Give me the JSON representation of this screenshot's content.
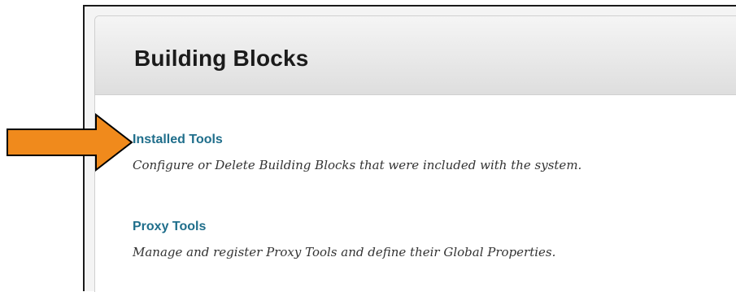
{
  "page": {
    "title": "Building Blocks"
  },
  "tools": [
    {
      "label": "Installed Tools",
      "description": "Configure or Delete Building Blocks that were included with the system."
    },
    {
      "label": "Proxy Tools",
      "description": "Manage and register Proxy Tools and define their Global Properties."
    }
  ],
  "annotation": {
    "icon": "arrow-right-icon",
    "fill_color": "#f08a1c",
    "stroke_color": "#000000"
  },
  "colors": {
    "link": "#1f6e8b",
    "title": "#1b1b1b",
    "description": "#333333"
  }
}
